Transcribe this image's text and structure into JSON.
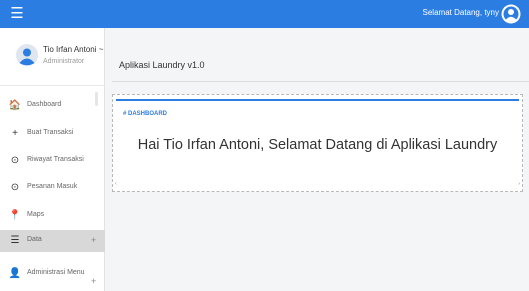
{
  "topbar": {
    "menu_icon": "hamburger-icon",
    "menu_glyph": "☰",
    "greeting": "Selamat Datang, tyny",
    "user_icon": "user-circle-icon",
    "background": "#2b7de1"
  },
  "sidebar": {
    "user_name": "Tio Irfan Antoni ~",
    "user_role": "Administrator",
    "items": [
      {
        "label": "Dashboard",
        "icon": "home-icon",
        "glyph": "🏠"
      },
      {
        "label": "Buat Transaksi",
        "icon": "plus-icon",
        "glyph": "+"
      },
      {
        "label": "Riwayat Transaksi",
        "icon": "clock-icon",
        "glyph": "⊙"
      },
      {
        "label": "Pesanan Masuk",
        "icon": "clock-icon",
        "glyph": "⊙"
      },
      {
        "label": "Maps",
        "icon": "map-marker-icon",
        "glyph": "📍"
      },
      {
        "label": "Data",
        "icon": "list-icon",
        "glyph": "☰",
        "active": true,
        "expand": "+"
      },
      {
        "label": "Administrasi Menu",
        "icon": "person-icon",
        "glyph": "👤",
        "expand": "+"
      }
    ]
  },
  "main": {
    "app_title": "Aplikasi Laundry v1.0",
    "panel_label": "# DASHBOARD",
    "panel_heading": "Hai Tio Irfan Antoni, Selamat Datang di Aplikasi Laundry",
    "accent_color": "#2b7de1",
    "scroll_left_glyph": "‹",
    "scroll_right_glyph": "›"
  }
}
